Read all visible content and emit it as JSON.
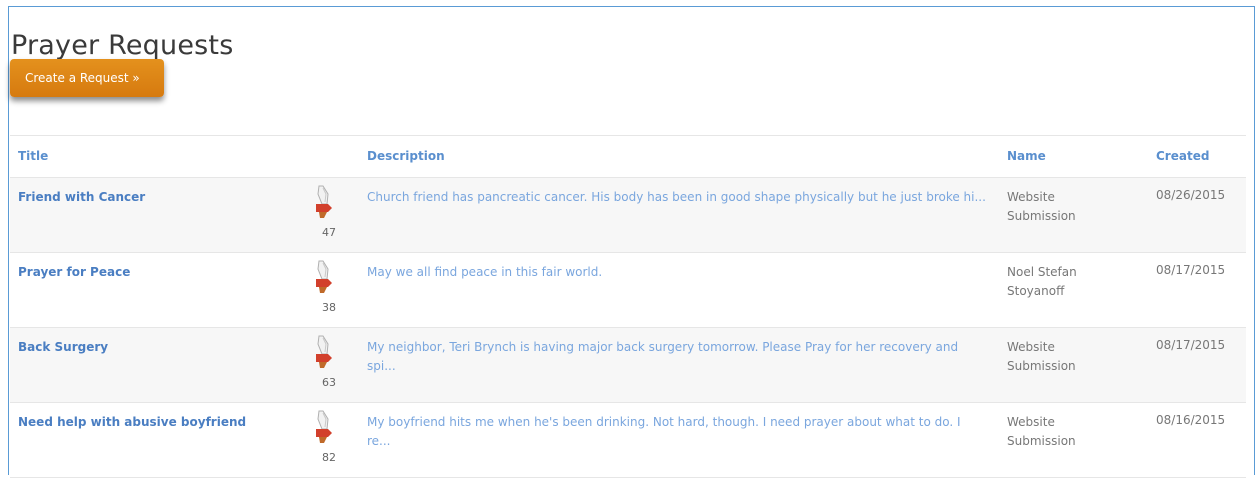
{
  "page": {
    "title": "Prayer Requests",
    "create_button": "Create a Request »"
  },
  "table": {
    "headers": {
      "title": "Title",
      "description": "Description",
      "name": "Name",
      "created": "Created"
    },
    "rows": [
      {
        "title": "Friend with Cancer",
        "count": "47",
        "description": "Church friend has pancreatic cancer. His body has been in good shape physically but he just broke hi...",
        "name": "Website Submission",
        "created": "08/26/2015"
      },
      {
        "title": "Prayer for Peace",
        "count": "38",
        "description": "May we all find peace in this fair world.",
        "name": "Noel Stefan Stoyanoff",
        "created": "08/17/2015"
      },
      {
        "title": "Back Surgery",
        "count": "63",
        "description": "My neighbor, Teri Brynch is having major back surgery tomorrow. Please Pray for her recovery and spi...",
        "name": "Website Submission",
        "created": "08/17/2015"
      },
      {
        "title": "Need help with abusive boyfriend",
        "count": "82",
        "description": "My boyfriend hits me when he's been drinking. Not hard, though. I need prayer about what to do. I re...",
        "name": "Website Submission",
        "created": "08/16/2015"
      }
    ]
  },
  "colors": {
    "accent_orange": "#dd8416",
    "link_blue": "#4a7ec2",
    "desc_blue": "#7aa6de",
    "frame_blue": "#5a9bd5"
  },
  "icons": {
    "pray": "praying-hands-icon"
  }
}
